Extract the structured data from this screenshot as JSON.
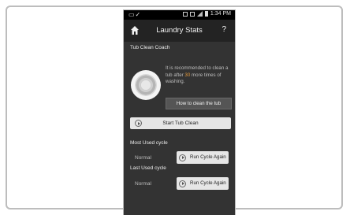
{
  "status_bar": {
    "time": "1:34 PM"
  },
  "header": {
    "title": "Laundry Stats",
    "help_label": "?"
  },
  "coach": {
    "section_label": "Tub Clean Coach",
    "tip_before": "It is recommended to clean a tub after ",
    "tip_number": "30",
    "tip_after": " more times of washing.",
    "howto_button": "How to clean the tub",
    "start_button": "Start Tub Clean"
  },
  "most_used": {
    "label": "Most Used cycle",
    "value": "Normal",
    "button": "Run Cycle Again"
  },
  "last_used": {
    "label": "Last Used cycle",
    "value": "Normal",
    "button": "Run Cycle Again"
  },
  "colors": {
    "background": "#333333",
    "header": "#232323",
    "accent": "#e49a3c",
    "button": "#e6e6e6"
  },
  "icons": [
    "home-icon",
    "help-icon",
    "play-icon",
    "checkmark-icon",
    "signal-icon",
    "battery-icon"
  ]
}
